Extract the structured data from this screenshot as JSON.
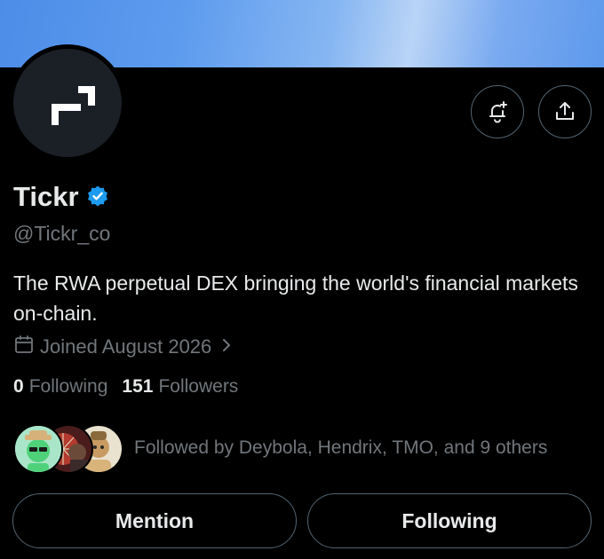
{
  "profile": {
    "name": "Tickr",
    "handle": "@Tickr_co",
    "bio": "The RWA perpetual DEX bringing the world's financial markets on-chain.",
    "joined": "Joined August 2026",
    "following_count": "0",
    "following_label": "Following",
    "followers_count": "151",
    "followers_label": "Followers",
    "followed_by": "Followed by Deybola, Hendrix, TMO, and 9 others"
  },
  "actions": {
    "mention_label": "Mention",
    "following_label": "Following",
    "notify_icon": "bell-plus-icon",
    "share_icon": "share-icon"
  },
  "colors": {
    "background": "#000000",
    "verified": "#1d9bf0",
    "secondary_text": "#71767b",
    "border": "#536471",
    "banner": "#5d9bee"
  }
}
